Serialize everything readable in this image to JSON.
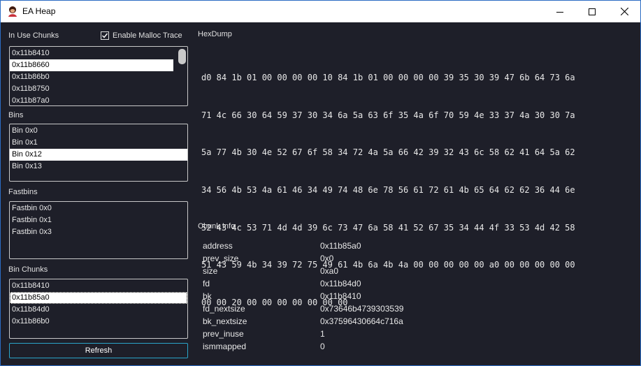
{
  "window": {
    "title": "EA Heap"
  },
  "in_use_chunks": {
    "label": "In Use Chunks",
    "items": [
      "0x11b8410",
      "0x11b8660",
      "0x11b86b0",
      "0x11b8750",
      "0x11b87a0"
    ],
    "selected_index": 1
  },
  "malloc_trace": {
    "label": "Enable Malloc Trace",
    "checked": true
  },
  "bins": {
    "label": "Bins",
    "items": [
      "Bin 0x0",
      "Bin 0x1",
      "Bin 0x12",
      "Bin 0x13"
    ],
    "selected_index": 2
  },
  "fastbins": {
    "label": "Fastbins",
    "items": [
      "Fastbin 0x0",
      "Fastbin 0x1",
      "Fastbin 0x3"
    ]
  },
  "bin_chunks": {
    "label": "Bin Chunks",
    "items": [
      "0x11b8410",
      "0x11b85a0",
      "0x11b84d0",
      "0x11b86b0"
    ],
    "selected_index": 1
  },
  "refresh": {
    "label": "Refresh"
  },
  "hexdump": {
    "label": "HexDump",
    "lines": [
      "d0 84 1b 01 00 00 00 00 10 84 1b 01 00 00 00 00 39 35 30 39 47 6b 64 73 6a",
      "71 4c 66 30 64 59 37 30 34 6a 5a 63 6f 35 4a 6f 70 59 4e 33 37 4a 30 30 7a",
      "5a 77 4b 30 4e 52 67 6f 58 34 72 4a 5a 66 42 39 32 43 6c 58 62 41 64 5a 62",
      "34 56 4b 53 4a 61 46 34 49 74 48 6e 78 56 61 72 61 4b 65 64 62 62 36 44 6e",
      "52 43 4c 53 71 4d 4d 39 6c 73 47 6a 58 41 52 67 35 34 44 4f 33 53 4d 42 58",
      "51 43 59 4b 34 39 72 75 49 61 4b 6a 4b 4a 00 00 00 00 00 a0 00 00 00 00 00",
      "00 00 20 00 00 00 00 00 00 00"
    ]
  },
  "chunk_info": {
    "label": "Chunk Info",
    "rows": [
      {
        "key": "address",
        "value": "0x11b85a0"
      },
      {
        "key": "prev_size",
        "value": "0x0"
      },
      {
        "key": "size",
        "value": "0xa0"
      },
      {
        "key": "fd",
        "value": "0x11b84d0"
      },
      {
        "key": "bk",
        "value": "0x11b8410"
      },
      {
        "key": "fd_nextsize",
        "value": "0x73646b4739303539"
      },
      {
        "key": "bk_nextsize",
        "value": "0x37596430664c716a"
      },
      {
        "key": "prev_inuse",
        "value": "1"
      },
      {
        "key": "ismmapped",
        "value": "0"
      }
    ]
  }
}
